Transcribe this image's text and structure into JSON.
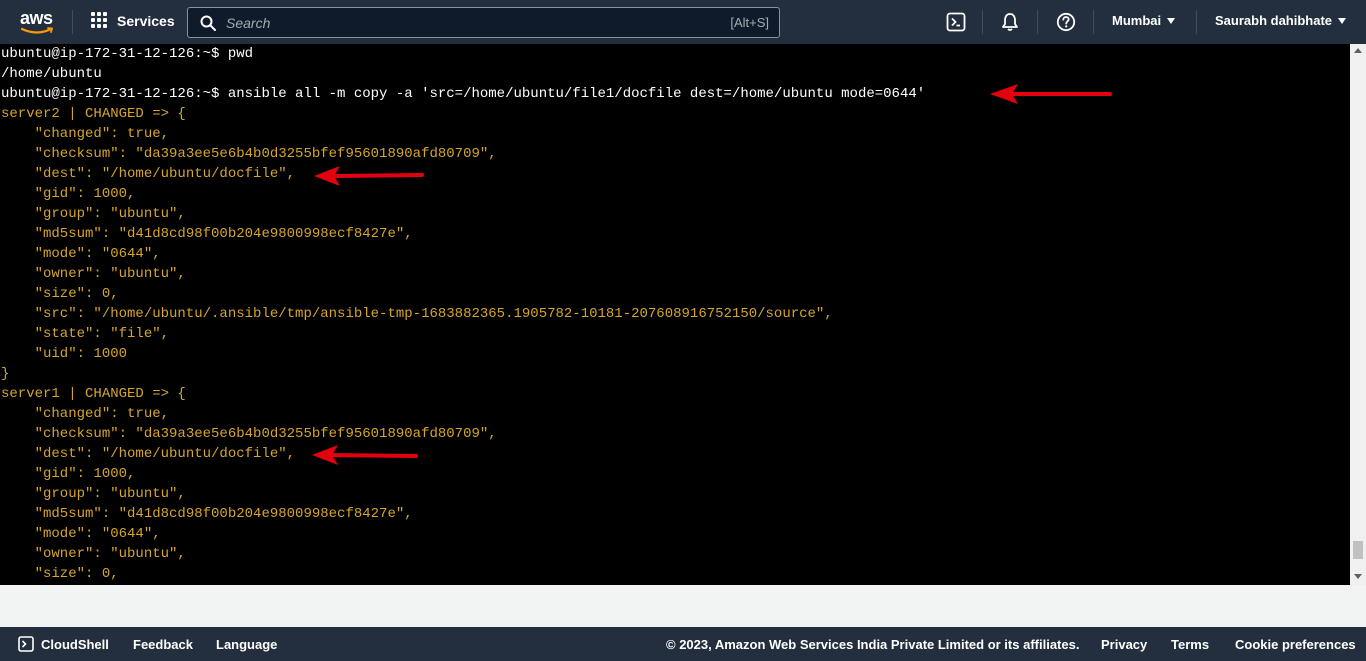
{
  "nav": {
    "logo": "aws",
    "services_label": "Services",
    "search_placeholder": "Search",
    "search_shortcut": "[Alt+S]",
    "icons": [
      "cloudshell-icon",
      "bell-icon",
      "help-icon"
    ],
    "region": "Mumbai",
    "user": "Saurabh dahibhate"
  },
  "terminal": {
    "lines": [
      {
        "color": "white",
        "text": "ubuntu@ip-172-31-12-126:~$ pwd"
      },
      {
        "color": "white",
        "text": "/home/ubuntu"
      },
      {
        "color": "white",
        "text": "ubuntu@ip-172-31-12-126:~$ ansible all -m copy -a 'src=/home/ubuntu/file1/docfile dest=/home/ubuntu mode=0644'"
      },
      {
        "color": "yellow",
        "text": "server2 | CHANGED => {"
      },
      {
        "color": "yellow",
        "text": "    \"changed\": true,"
      },
      {
        "color": "yellow",
        "text": "    \"checksum\": \"da39a3ee5e6b4b0d3255bfef95601890afd80709\","
      },
      {
        "color": "yellow",
        "text": "    \"dest\": \"/home/ubuntu/docfile\","
      },
      {
        "color": "yellow",
        "text": "    \"gid\": 1000,"
      },
      {
        "color": "yellow",
        "text": "    \"group\": \"ubuntu\","
      },
      {
        "color": "yellow",
        "text": "    \"md5sum\": \"d41d8cd98f00b204e9800998ecf8427e\","
      },
      {
        "color": "yellow",
        "text": "    \"mode\": \"0644\","
      },
      {
        "color": "yellow",
        "text": "    \"owner\": \"ubuntu\","
      },
      {
        "color": "yellow",
        "text": "    \"size\": 0,"
      },
      {
        "color": "yellow",
        "text": "    \"src\": \"/home/ubuntu/.ansible/tmp/ansible-tmp-1683882365.1905782-10181-207608916752150/source\","
      },
      {
        "color": "yellow",
        "text": "    \"state\": \"file\","
      },
      {
        "color": "yellow",
        "text": "    \"uid\": 1000"
      },
      {
        "color": "yellow",
        "text": "}"
      },
      {
        "color": "yellow",
        "text": "server1 | CHANGED => {"
      },
      {
        "color": "yellow",
        "text": "    \"changed\": true,"
      },
      {
        "color": "yellow",
        "text": "    \"checksum\": \"da39a3ee5e6b4b0d3255bfef95601890afd80709\","
      },
      {
        "color": "yellow",
        "text": "    \"dest\": \"/home/ubuntu/docfile\","
      },
      {
        "color": "yellow",
        "text": "    \"gid\": 1000,"
      },
      {
        "color": "yellow",
        "text": "    \"group\": \"ubuntu\","
      },
      {
        "color": "yellow",
        "text": "    \"md5sum\": \"d41d8cd98f00b204e9800998ecf8427e\","
      },
      {
        "color": "yellow",
        "text": "    \"mode\": \"0644\","
      },
      {
        "color": "yellow",
        "text": "    \"owner\": \"ubuntu\","
      },
      {
        "color": "yellow",
        "text": "    \"size\": 0,"
      }
    ]
  },
  "footer": {
    "cloudshell": "CloudShell",
    "feedback": "Feedback",
    "language": "Language",
    "copyright": "© 2023, Amazon Web Services India Private Limited or its affiliates.",
    "privacy": "Privacy",
    "terms": "Terms",
    "cookies": "Cookie preferences"
  },
  "colors": {
    "nav_bg": "#232f3e",
    "terminal_bg": "#000000",
    "terminal_text": "#ffffff",
    "json_text": "#d6a52a",
    "annotation_arrow": "#e3000f"
  }
}
